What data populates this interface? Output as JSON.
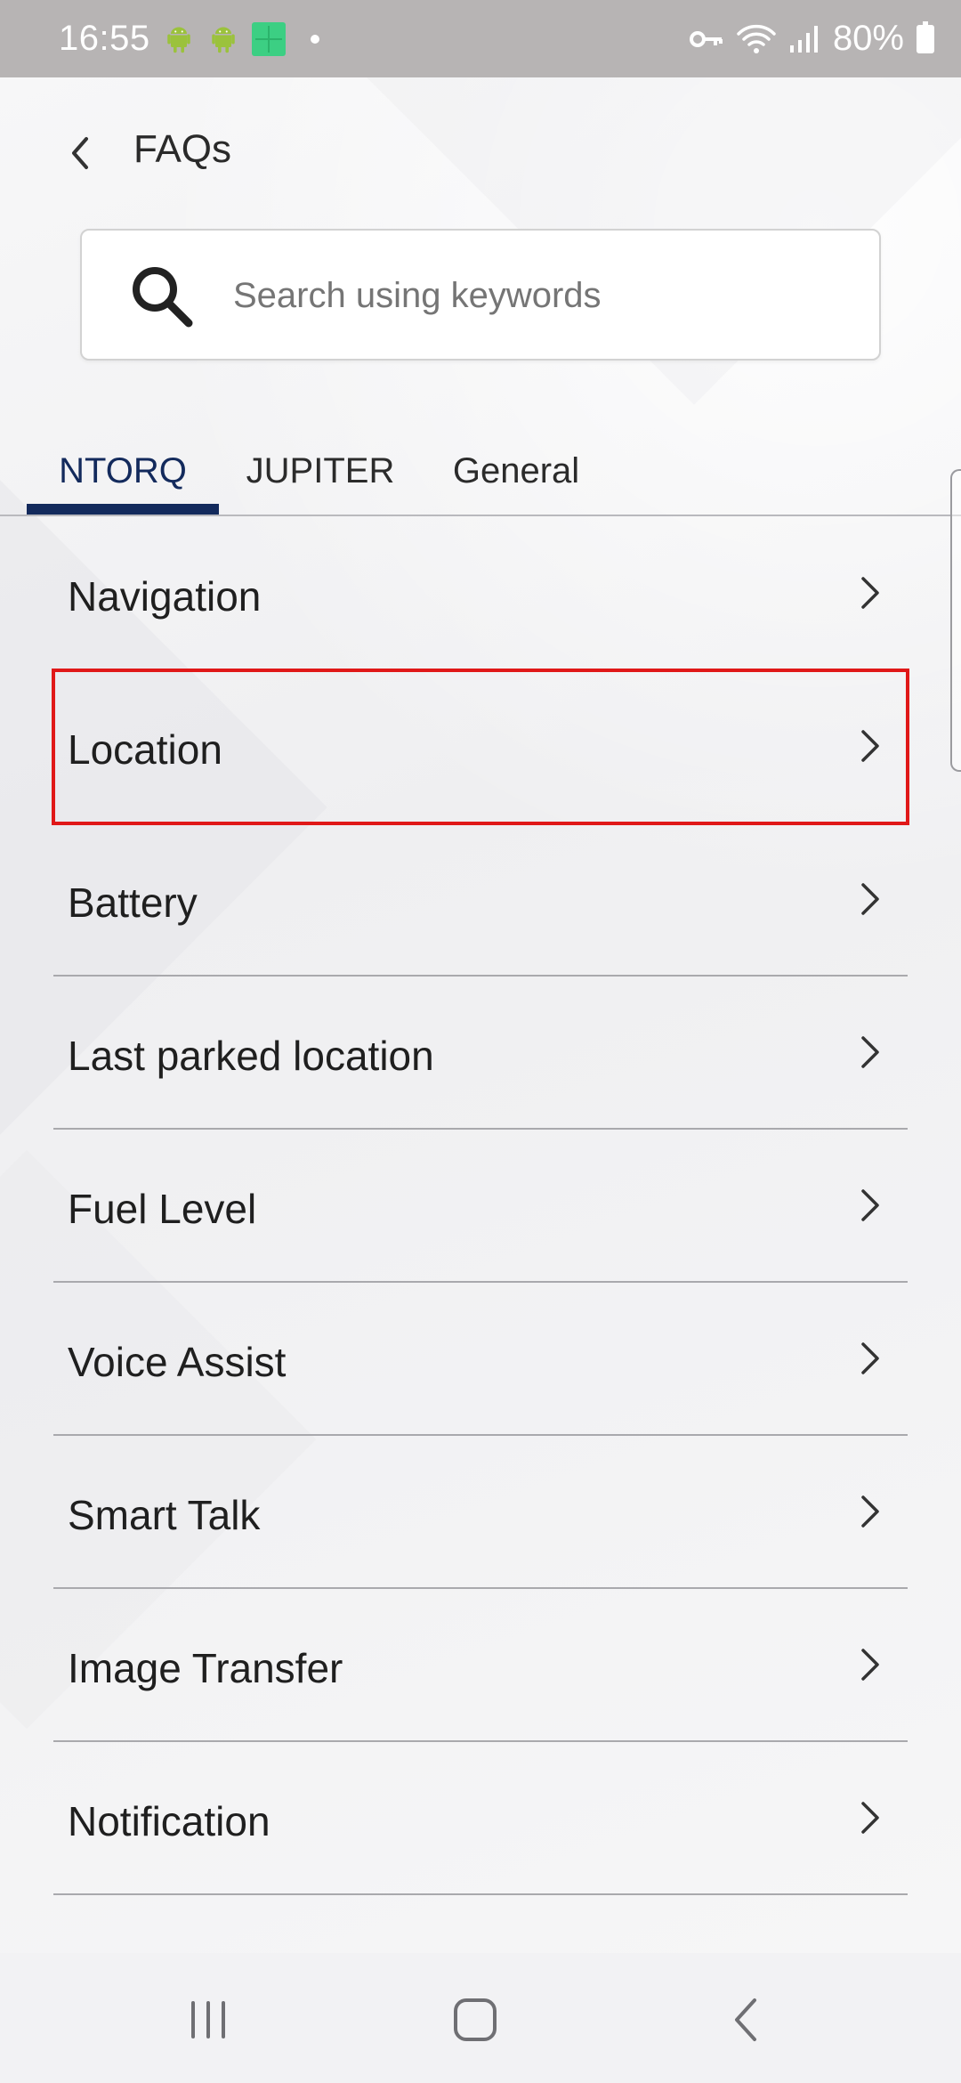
{
  "status_bar": {
    "time": "16:55",
    "battery": "80%",
    "icons": [
      "android-icon",
      "android-icon",
      "grid-app-icon",
      "dot-icon",
      "key-icon",
      "wifi-icon",
      "signal-icon",
      "battery-icon"
    ]
  },
  "header": {
    "title": "FAQs",
    "back_icon": "chevron-left-icon"
  },
  "search": {
    "placeholder": "Search using keywords",
    "value": "",
    "icon": "search-icon"
  },
  "tabs": [
    {
      "label": "NTORQ",
      "active": true
    },
    {
      "label": "JUPITER",
      "active": false
    },
    {
      "label": "General",
      "active": false
    }
  ],
  "faq_items": [
    {
      "label": "Navigation"
    },
    {
      "label": "Location",
      "highlighted": true
    },
    {
      "label": "Battery"
    },
    {
      "label": "Last parked location"
    },
    {
      "label": "Fuel Level"
    },
    {
      "label": "Voice Assist"
    },
    {
      "label": "Smart Talk"
    },
    {
      "label": "Image Transfer"
    },
    {
      "label": "Notification"
    }
  ],
  "nav_bar": {
    "buttons": [
      "recents-icon",
      "home-icon",
      "back-icon"
    ]
  },
  "colors": {
    "accent": "#132a5c",
    "highlight": "#e01818",
    "status_bar": "#b7b4b4"
  }
}
